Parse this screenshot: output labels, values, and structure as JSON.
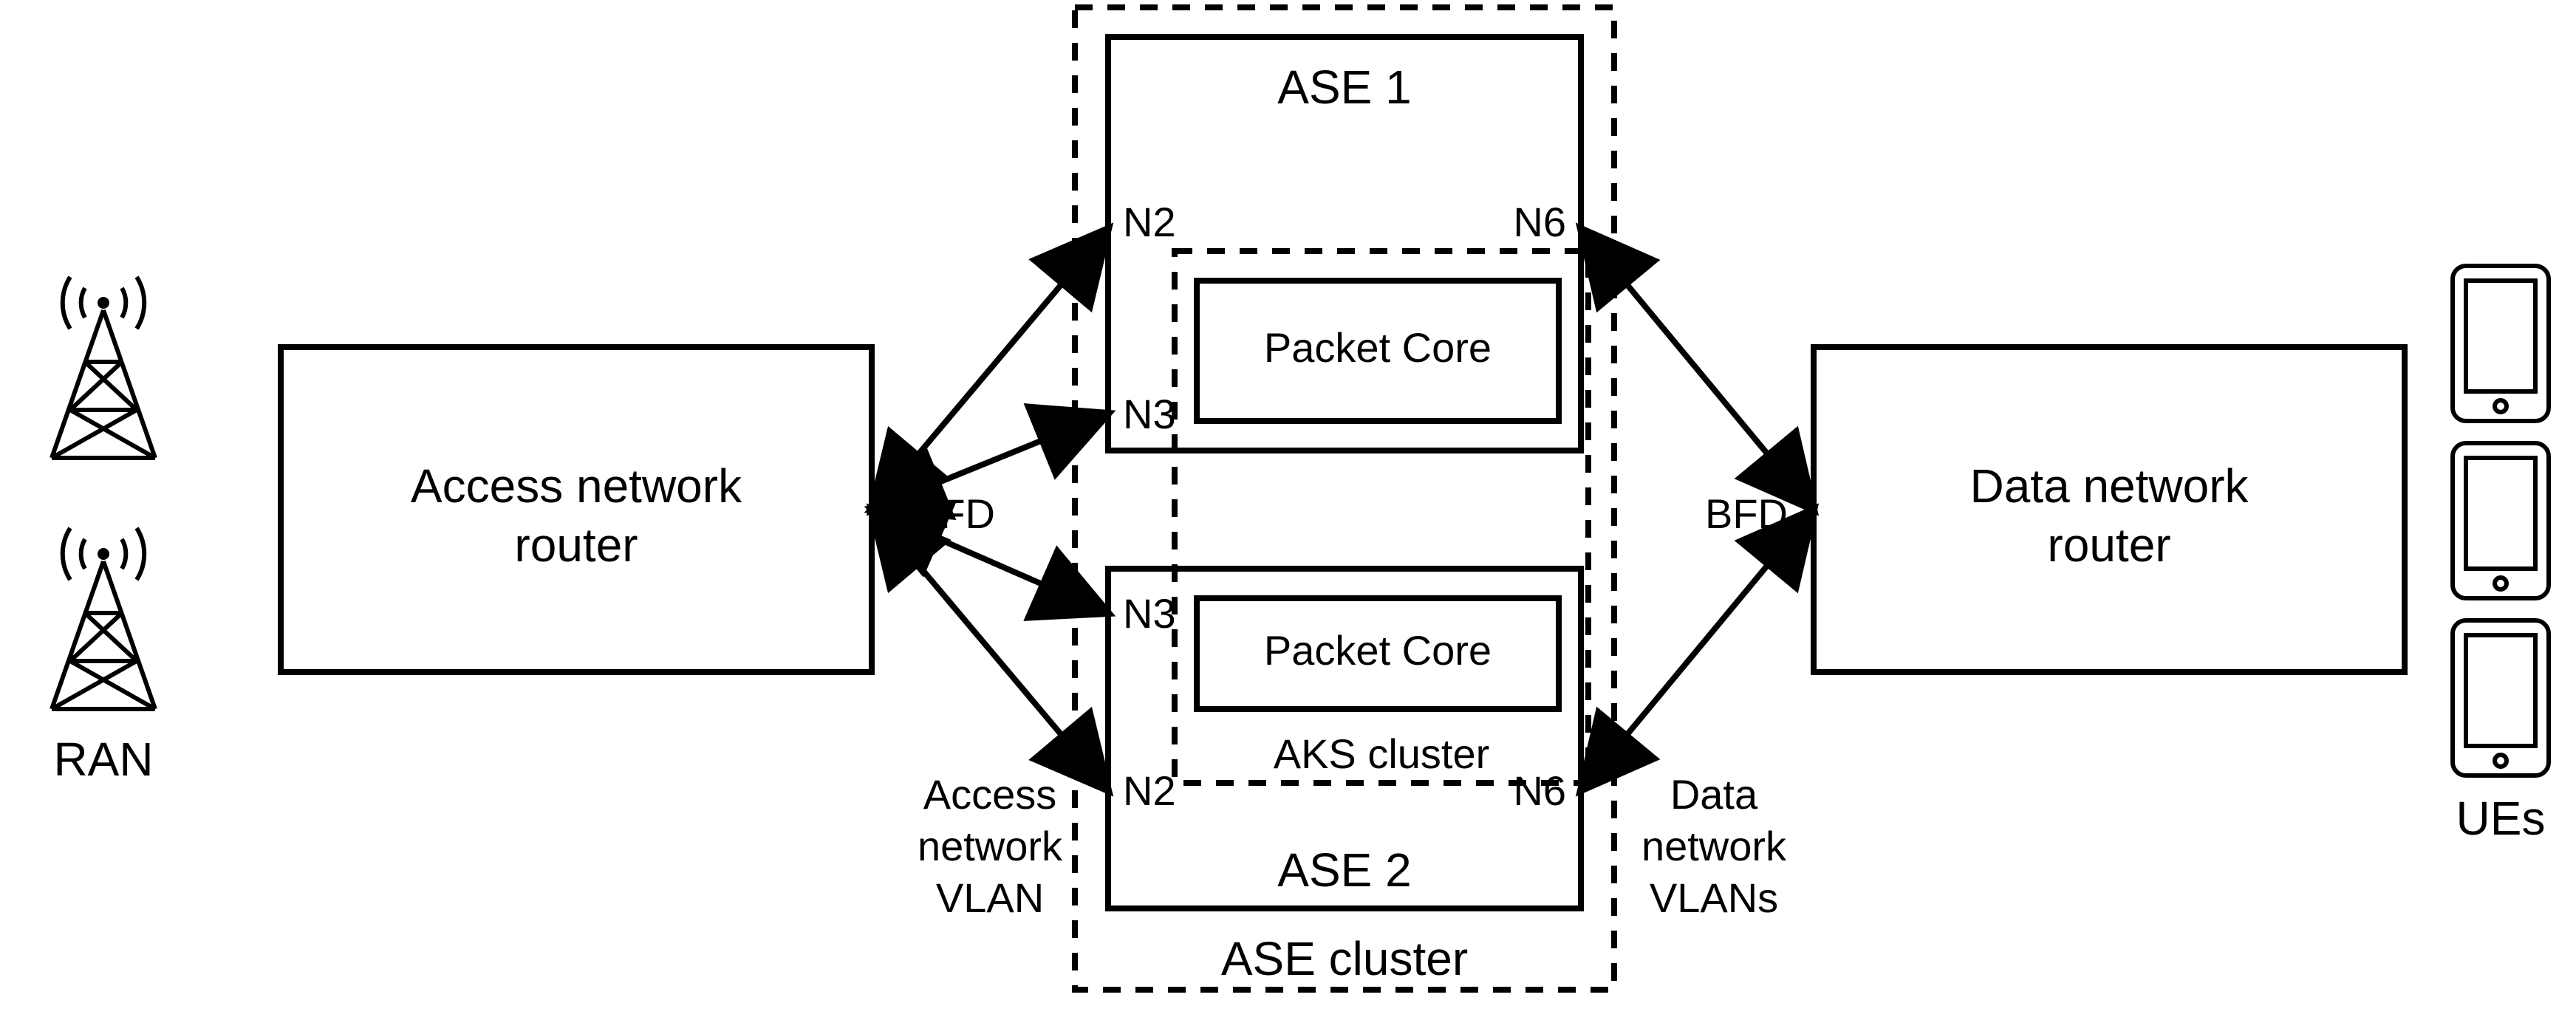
{
  "ran_label": "RAN",
  "ues_label": "UEs",
  "access_router": {
    "line1": "Access network",
    "line2": "router"
  },
  "data_router": {
    "line1": "Data network",
    "line2": "router"
  },
  "ase_cluster_label": "ASE cluster",
  "aks_cluster_label": "AKS cluster",
  "ase1": {
    "title": "ASE 1",
    "packet_core": "Packet Core",
    "n2": "N2",
    "n3": "N3",
    "n6": "N6"
  },
  "ase2": {
    "title": "ASE 2",
    "packet_core": "Packet Core",
    "n2": "N2",
    "n3": "N3",
    "n6": "N6"
  },
  "bfd_left": "BFD",
  "bfd_right": "BFD",
  "access_vlan": {
    "l1": "Access",
    "l2": "network",
    "l3": "VLAN"
  },
  "data_vlan": {
    "l1": "Data",
    "l2": "network",
    "l3": "VLANs"
  }
}
